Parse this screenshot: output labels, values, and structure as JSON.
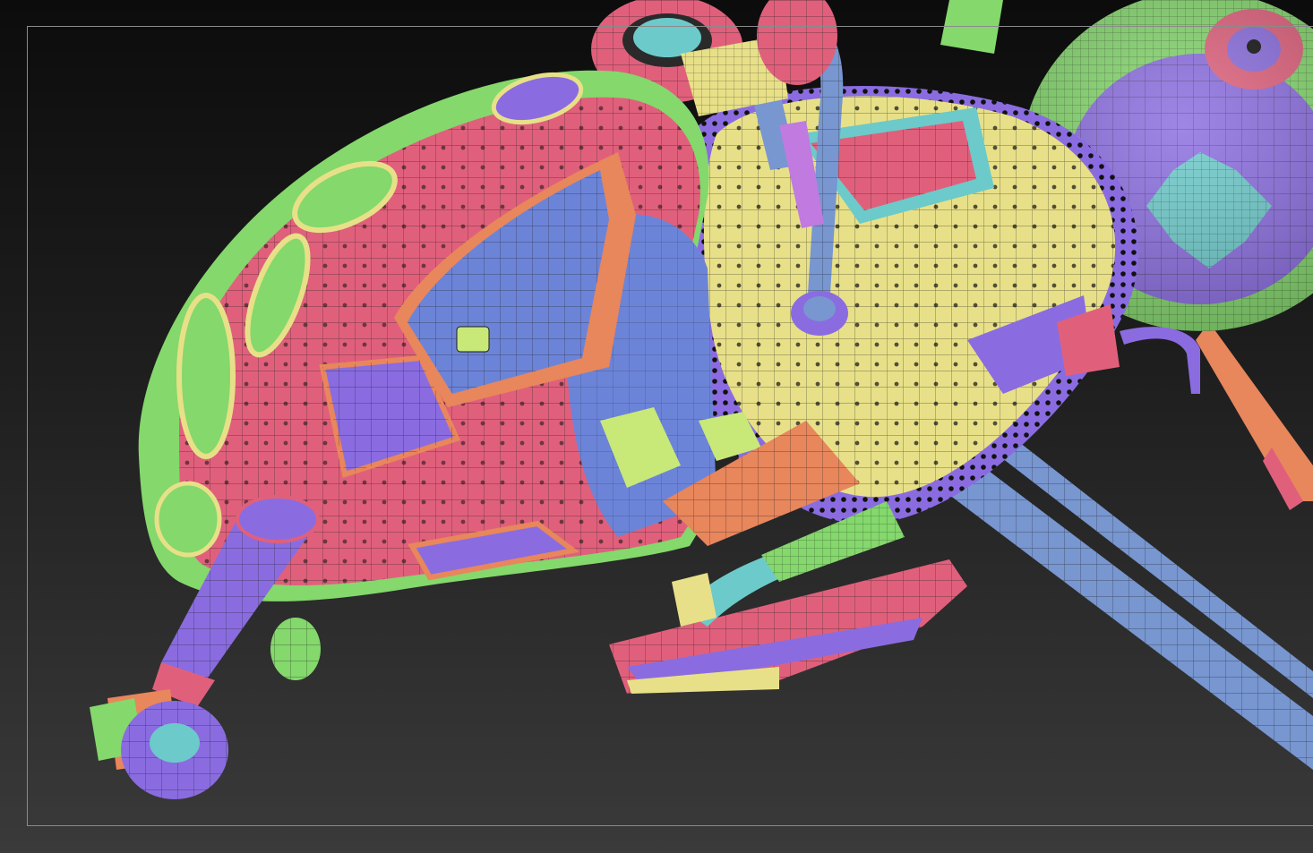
{
  "viewport": {
    "mode": "polyframe-wireframe",
    "background_top": "#0c0c0c",
    "background_bottom": "#3a3a3a",
    "frame_color": "#8a8a8a"
  },
  "palette": {
    "pink": "#e0607c",
    "yellow": "#e8e088",
    "green": "#84d86c",
    "purple": "#8a6ce0",
    "blue": "#6c84d8",
    "steel": "#7896d0",
    "cyan": "#6ccaca",
    "orange": "#e8865c",
    "wire": "#1a1a1a"
  },
  "model": {
    "subject": "spacecraft-hull",
    "parts": [
      "fuselage",
      "cockpit-canopy",
      "rear-ring",
      "engine-pod",
      "nose-probe",
      "landing-struts",
      "lower-skid",
      "top-wheel"
    ]
  }
}
